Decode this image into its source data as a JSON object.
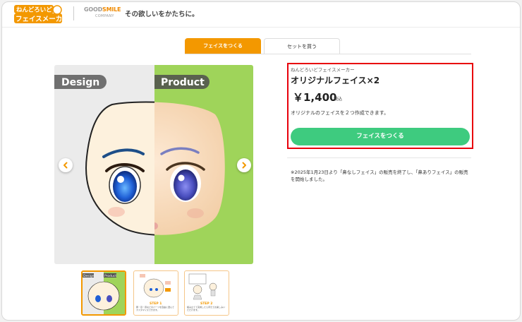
{
  "header": {
    "logo_line1": "ねんどろいど",
    "logo_line2": "フェイスメーカー",
    "partner_logo_line1_a": "GOOD",
    "partner_logo_line1_b": "SMILE",
    "partner_logo_line2": "COMPANY",
    "tagline": "その欲しいをかたちに。"
  },
  "tabs": [
    {
      "label": "フェイスをつくる",
      "active": true
    },
    {
      "label": "セットを買う",
      "active": false
    }
  ],
  "gallery": {
    "label_design": "Design",
    "label_product": "Product",
    "thumbs": [
      {
        "label_a": "Design",
        "label_b": "Product"
      },
      {
        "step": "STEP 1",
        "text": "顔・目・眉などのパーツを自由に選んでカスタマイズできます。"
      },
      {
        "step": "STEP 2",
        "text": "組み立てて完成したら手元でお楽しみいただけます。"
      }
    ]
  },
  "product": {
    "brand": "ねんどろいどフェイスメーカー",
    "title": "オリジナルフェイス×2",
    "price": "￥1,400",
    "tax_label": "税込",
    "description": "オリジナルのフェイスを２つ作成できます。",
    "cta_label": "フェイスをつくる"
  },
  "notice": "※2025年1月23日より「鼻なしフェイス」の販売を終了し、「鼻ありフェイス」の販売を開始しました。",
  "colors": {
    "accent": "#f39800",
    "cta": "#3ecb7f",
    "highlight_border": "#e8000b"
  }
}
